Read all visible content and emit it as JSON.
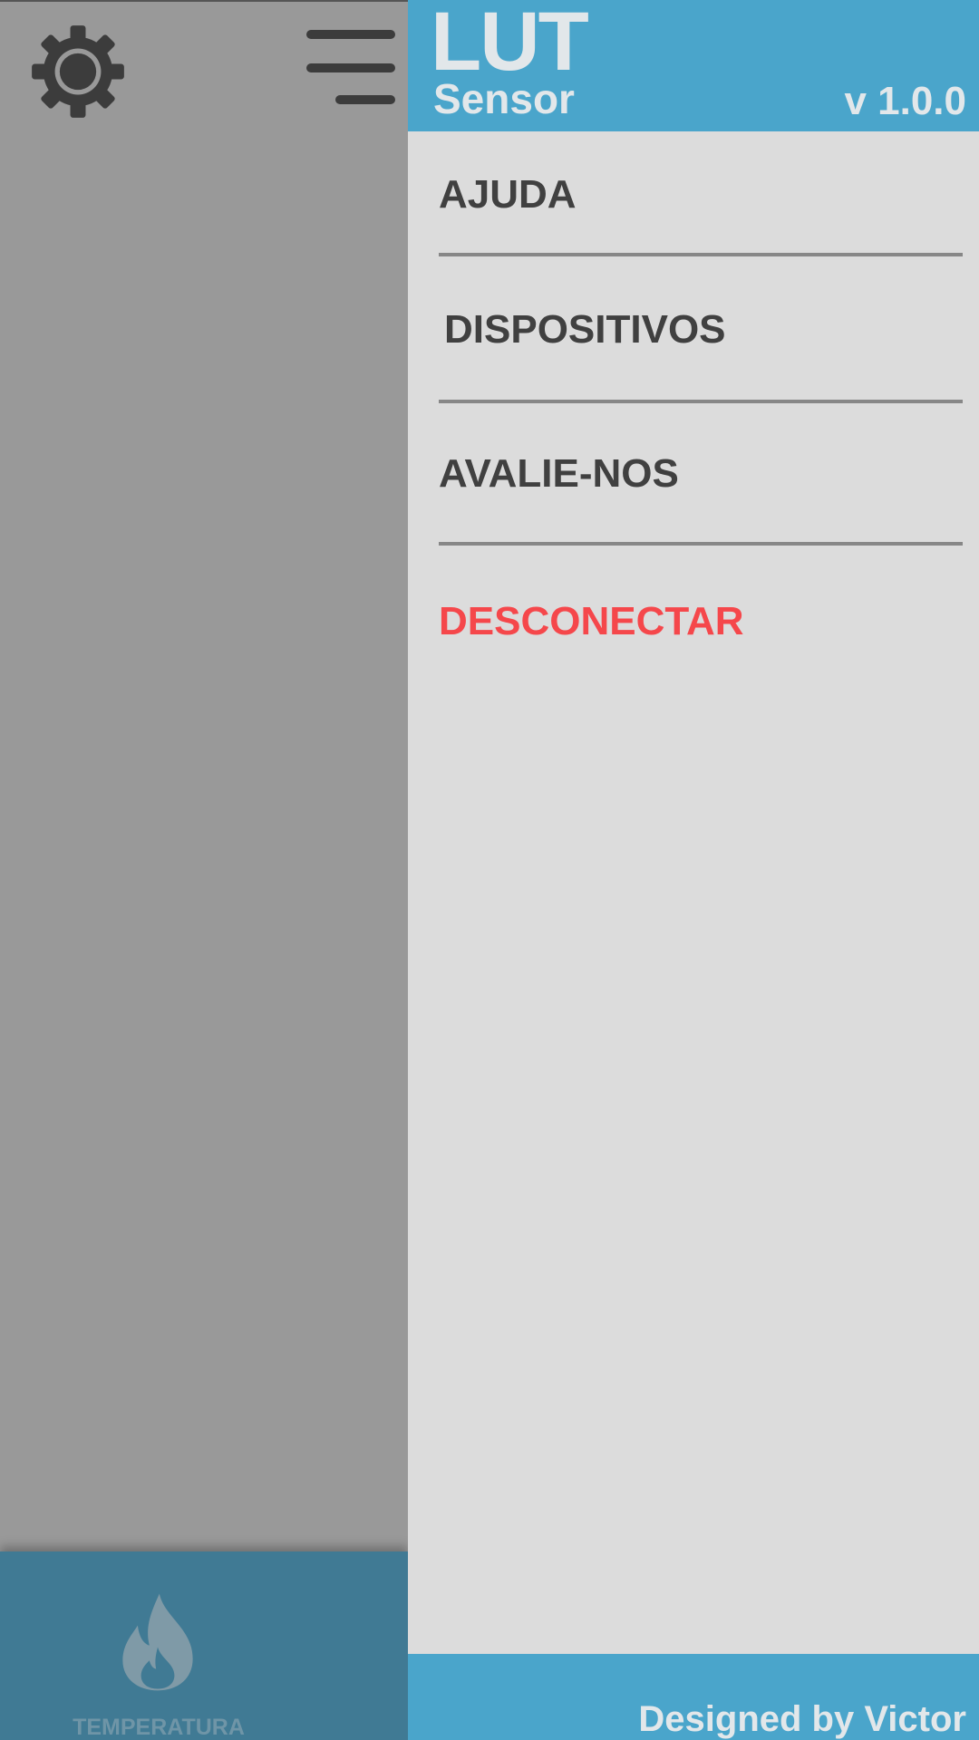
{
  "main": {
    "settings_icon": "gear-icon",
    "menu_icon": "hamburger-menu-icon",
    "bottom_nav": {
      "tabs": [
        {
          "label": "TEMPERATURA",
          "icon": "flame-icon"
        }
      ]
    }
  },
  "drawer": {
    "header": {
      "logo_line1": "LUT",
      "logo_line2": "Sensor",
      "version": "v 1.0.0"
    },
    "items": [
      {
        "label": "AJUDA"
      },
      {
        "label": "DISPOSITIVOS"
      },
      {
        "label": "AVALIE-NOS"
      },
      {
        "label": "DESCONECTAR"
      }
    ],
    "footer": {
      "credit": "Designed by Victor"
    }
  },
  "colors": {
    "accent": "#4aa5cb",
    "drawer_background": "#dcdcdc",
    "scrim": "#999999",
    "danger": "#f5474b",
    "menu_text": "#404040"
  }
}
